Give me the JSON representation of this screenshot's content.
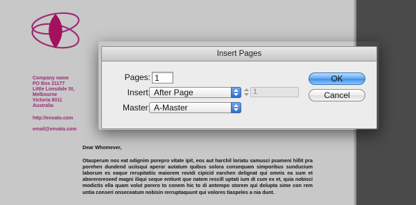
{
  "document": {
    "company": {
      "name": "Company name",
      "address_lines": [
        "PO Box 21177",
        "Little Lonsdale St,",
        "Melbourne",
        "Victoria 8011",
        "Australia"
      ],
      "url": "http://envato.com",
      "email": "email@envato.com"
    },
    "letter": {
      "greeting": "Dear Whomever,",
      "body": "Otasperum nos eat odignim porepro vitate ipit, eos aut harchil loriatu samusci psameni hillit pra porehen dundend uciisqui aperor autatum quibus solora consequam simporibus sunducium laborum es eaque rerupitatiis maiorem rovidi cipicid earchen delignat qui omnis ea sum et aboreroreseed magni iliqui seque entiunt que natem rescill uptati ium di cum ex et, quia nobisci modictis ella quam volut porero to conem hic to di antempo storem qui dolupta sime con rem untia conseri onseceatum nobisin rerruptaquunt qui volores tiaspeles a nia dunt."
    },
    "colors": {
      "brand": "#9b2a74"
    }
  },
  "dialog": {
    "title": "Insert Pages",
    "pages_label": "Pages:",
    "pages_value": "1",
    "insert_label": "Insert:",
    "insert_value": "After Page",
    "insert_page_value": "1",
    "master_label": "Master:",
    "master_value": "A-Master",
    "ok_label": "OK",
    "cancel_label": "Cancel",
    "colors": {
      "accent": "#3d8fe6"
    }
  }
}
